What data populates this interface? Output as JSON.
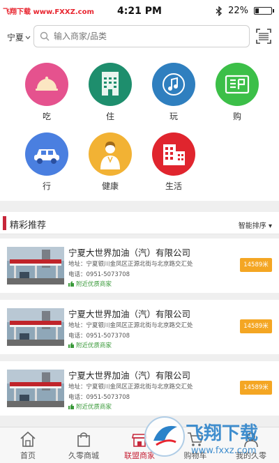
{
  "status": {
    "watermark": "飞翔下载 www.FXXZ.com",
    "time": "4:21 PM",
    "battery": "22%",
    "battery_level": 0.22
  },
  "search": {
    "city": "宁夏",
    "placeholder": "输入商家/品类"
  },
  "categories": [
    {
      "label": "吃",
      "icon": "dining-cloche-icon",
      "color": "#e5528e"
    },
    {
      "label": "住",
      "icon": "hotel-icon",
      "color": "#1e8e6d"
    },
    {
      "label": "玩",
      "icon": "music-note-icon",
      "color": "#2f7fbf"
    },
    {
      "label": "购",
      "icon": "shopping-icon",
      "color": "#3cbf48"
    },
    {
      "label": "行",
      "icon": "car-icon",
      "color": "#4a7fe0"
    },
    {
      "label": "健康",
      "icon": "doctor-icon",
      "color": "#f2b234"
    },
    {
      "label": "生活",
      "icon": "building-icon",
      "color": "#e0252e"
    }
  ],
  "section": {
    "title": "精彩推荐",
    "sort_label": "智能排序"
  },
  "merchants": [
    {
      "name": "宁夏大世界加油（汽）有限公司",
      "address": "地址：宁夏银川金凤区正源北街与北京路交汇处",
      "phone": "电话：0951-5073708",
      "tag": "附近优质商家",
      "distance": "14589米"
    },
    {
      "name": "宁夏大世界加油（汽）有限公司",
      "address": "地址：宁夏银川金凤区正源北街与北京路交汇处",
      "phone": "电话：0951-5073708",
      "tag": "附近优质商家",
      "distance": "14589米"
    },
    {
      "name": "宁夏大世界加油（汽）有限公司",
      "address": "地址：宁夏银川金凤区正源北街与北京路交汇处",
      "phone": "电话：0951-5073708",
      "tag": "附近优质商家",
      "distance": "14589米"
    }
  ],
  "tabs": [
    {
      "label": "首页",
      "icon": "home-icon"
    },
    {
      "label": "久零商城",
      "icon": "bag-icon"
    },
    {
      "label": "联盟商家",
      "icon": "shop-icon"
    },
    {
      "label": "购物车",
      "icon": "cart-icon"
    },
    {
      "label": "我的久零",
      "icon": "user-icon"
    }
  ],
  "watermark_logo": {
    "text": "飞翔下载",
    "url_text": "www.fxxz.com"
  },
  "colors": {
    "accent": "#c7263a",
    "badge": "#f4a623",
    "tag": "#3a9a3a"
  }
}
